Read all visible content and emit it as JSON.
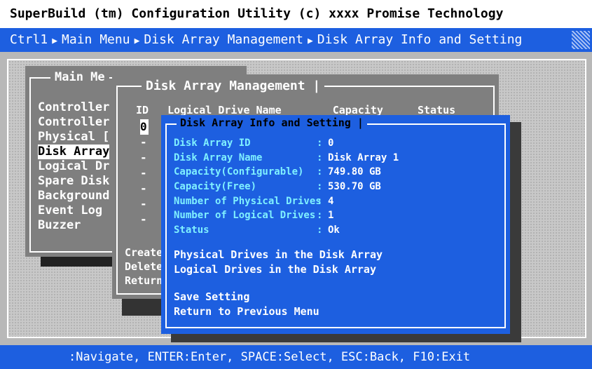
{
  "title": "SuperBuild (tm) Configuration Utility (c) xxxx Promise Technology",
  "breadcrumb": [
    "Ctrl1",
    "Main Menu",
    "Disk Array Management",
    "Disk Array Info and Setting"
  ],
  "main_menu": {
    "title": "Main Me",
    "items": [
      "Controller",
      "Controller",
      "Physical [",
      "Disk Array",
      "Logical Dr",
      "Spare Disk",
      "Background",
      "Event Log",
      "Buzzer"
    ],
    "selected_index": 3
  },
  "dam": {
    "title": "Disk Array Management |",
    "headers": {
      "id": "ID",
      "name": "Logical Drive Name",
      "capacity": "Capacity",
      "status": "Status"
    },
    "ids": [
      "0",
      "-",
      "-",
      "-",
      "-",
      "-",
      "-"
    ],
    "bottom": [
      "Create",
      "Delete",
      "Return"
    ]
  },
  "info": {
    "title": "Disk Array Info and Setting |",
    "fields": [
      {
        "label": "Disk Array ID",
        "value": "0"
      },
      {
        "label": "Disk Array Name",
        "value": "Disk Array 1"
      },
      {
        "label": "Capacity(Configurable)",
        "value": "749.80 GB"
      },
      {
        "label": "Capacity(Free)",
        "value": "530.70 GB"
      },
      {
        "label": "Number of Physical Drives",
        "value": "4"
      },
      {
        "label": "Number of Logical Drives",
        "value": "1"
      },
      {
        "label": "Status",
        "value": "Ok"
      }
    ],
    "sep": ":",
    "actions1": [
      "Physical Drives in the Disk Array",
      "Logical Drives in the Disk Array"
    ],
    "actions2": [
      "Save Setting",
      "Return to Previous Menu"
    ]
  },
  "statusbar": ":Navigate, ENTER:Enter, SPACE:Select, ESC:Back, F10:Exit",
  "colors": {
    "blue": "#1d5fe0",
    "gray": "#7f7f7f",
    "cyan": "#7ff0ff",
    "desktop": "#c8c8c8"
  }
}
